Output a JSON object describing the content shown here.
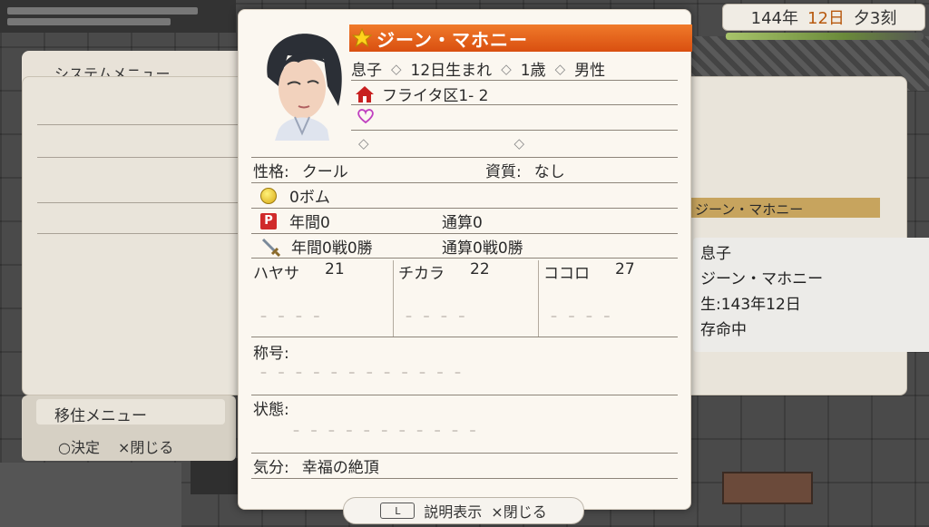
{
  "date": {
    "year": "144年",
    "day": "12日",
    "time": "夕3刻"
  },
  "system_menu": {
    "title": "システムメニュー",
    "submenu_label": "移住メニュー",
    "confirm": "○決定",
    "close": "×閉じる"
  },
  "side_panel": {
    "name": "ジーン・マホニー",
    "relation": "息子",
    "person": "ジーン・マホニー",
    "birth": "生:143年12日",
    "status": "存命中"
  },
  "profile": {
    "name": "ジーン・マホニー",
    "relation": "息子",
    "birthday": "12日生まれ",
    "age": "1歳",
    "gender": "男性",
    "address": "フライタ区1- 2",
    "personality_label": "性格:",
    "personality": "クール",
    "talent_label": "資質:",
    "talent": "なし",
    "money": "0ボム",
    "points_year": "年間0",
    "points_total": "通算0",
    "battles_year": "年間0戦0勝",
    "battles_total": "通算0戦0勝",
    "stats": [
      {
        "label": "ハヤサ",
        "value": "21"
      },
      {
        "label": "チカラ",
        "value": "22"
      },
      {
        "label": "ココロ",
        "value": "27"
      }
    ],
    "title_label": "称号:",
    "state_label": "状態:",
    "mood_label": "気分:",
    "mood": "幸福の絶頂"
  },
  "controls": {
    "key": "L",
    "explain": "説明表示",
    "close": "×閉じる"
  },
  "colors": {
    "name_bar": "#e8641a",
    "accent_heart": "#c040c0",
    "house_red": "#c82020"
  }
}
